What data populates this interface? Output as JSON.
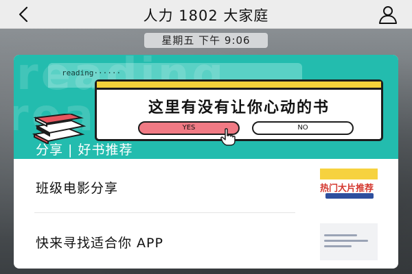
{
  "header": {
    "title": "人力 1802 大家庭",
    "back_icon": "chevron-left-icon",
    "profile_icon": "person-icon"
  },
  "timestamp": "星期五 下午 9:06",
  "shared_card": {
    "banner": {
      "reading_text": "reading······",
      "popup_question": "这里有没有让你心动的书",
      "yes_label": "YES",
      "no_label": "NO",
      "caption": "分享 | 好书推荐"
    },
    "items": [
      {
        "title": "班级电影分享",
        "thumbnail_text": "热门大片推荐"
      },
      {
        "title": "快来寻找适合你 APP"
      }
    ]
  },
  "colors": {
    "navbar": "#ededed",
    "banner_teal": "#23bcae",
    "popup_yellow": "#f4d23a",
    "yes_pink": "#f07a84"
  }
}
